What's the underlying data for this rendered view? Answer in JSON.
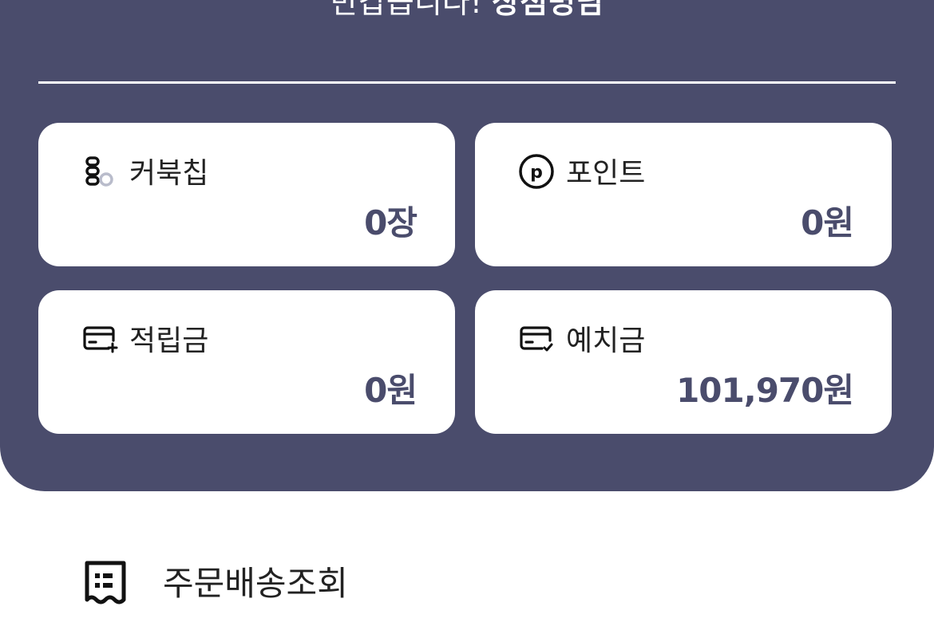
{
  "header": {
    "greeting_prefix": "반갑습니다!",
    "greeting_name": "상점명님",
    "background_color": "#4a4c6c"
  },
  "cards": [
    {
      "icon": "coupon-chip-icon",
      "label": "커북칩",
      "value": "0장"
    },
    {
      "icon": "point-icon",
      "label": "포인트",
      "value": "0원"
    },
    {
      "icon": "card-plus-icon",
      "label": "적립금",
      "value": "0원"
    },
    {
      "icon": "card-check-icon",
      "label": "예치금",
      "value": "101,970원"
    }
  ],
  "menu": {
    "items": [
      {
        "icon": "receipt-icon",
        "label": "주문배송조회"
      }
    ]
  }
}
